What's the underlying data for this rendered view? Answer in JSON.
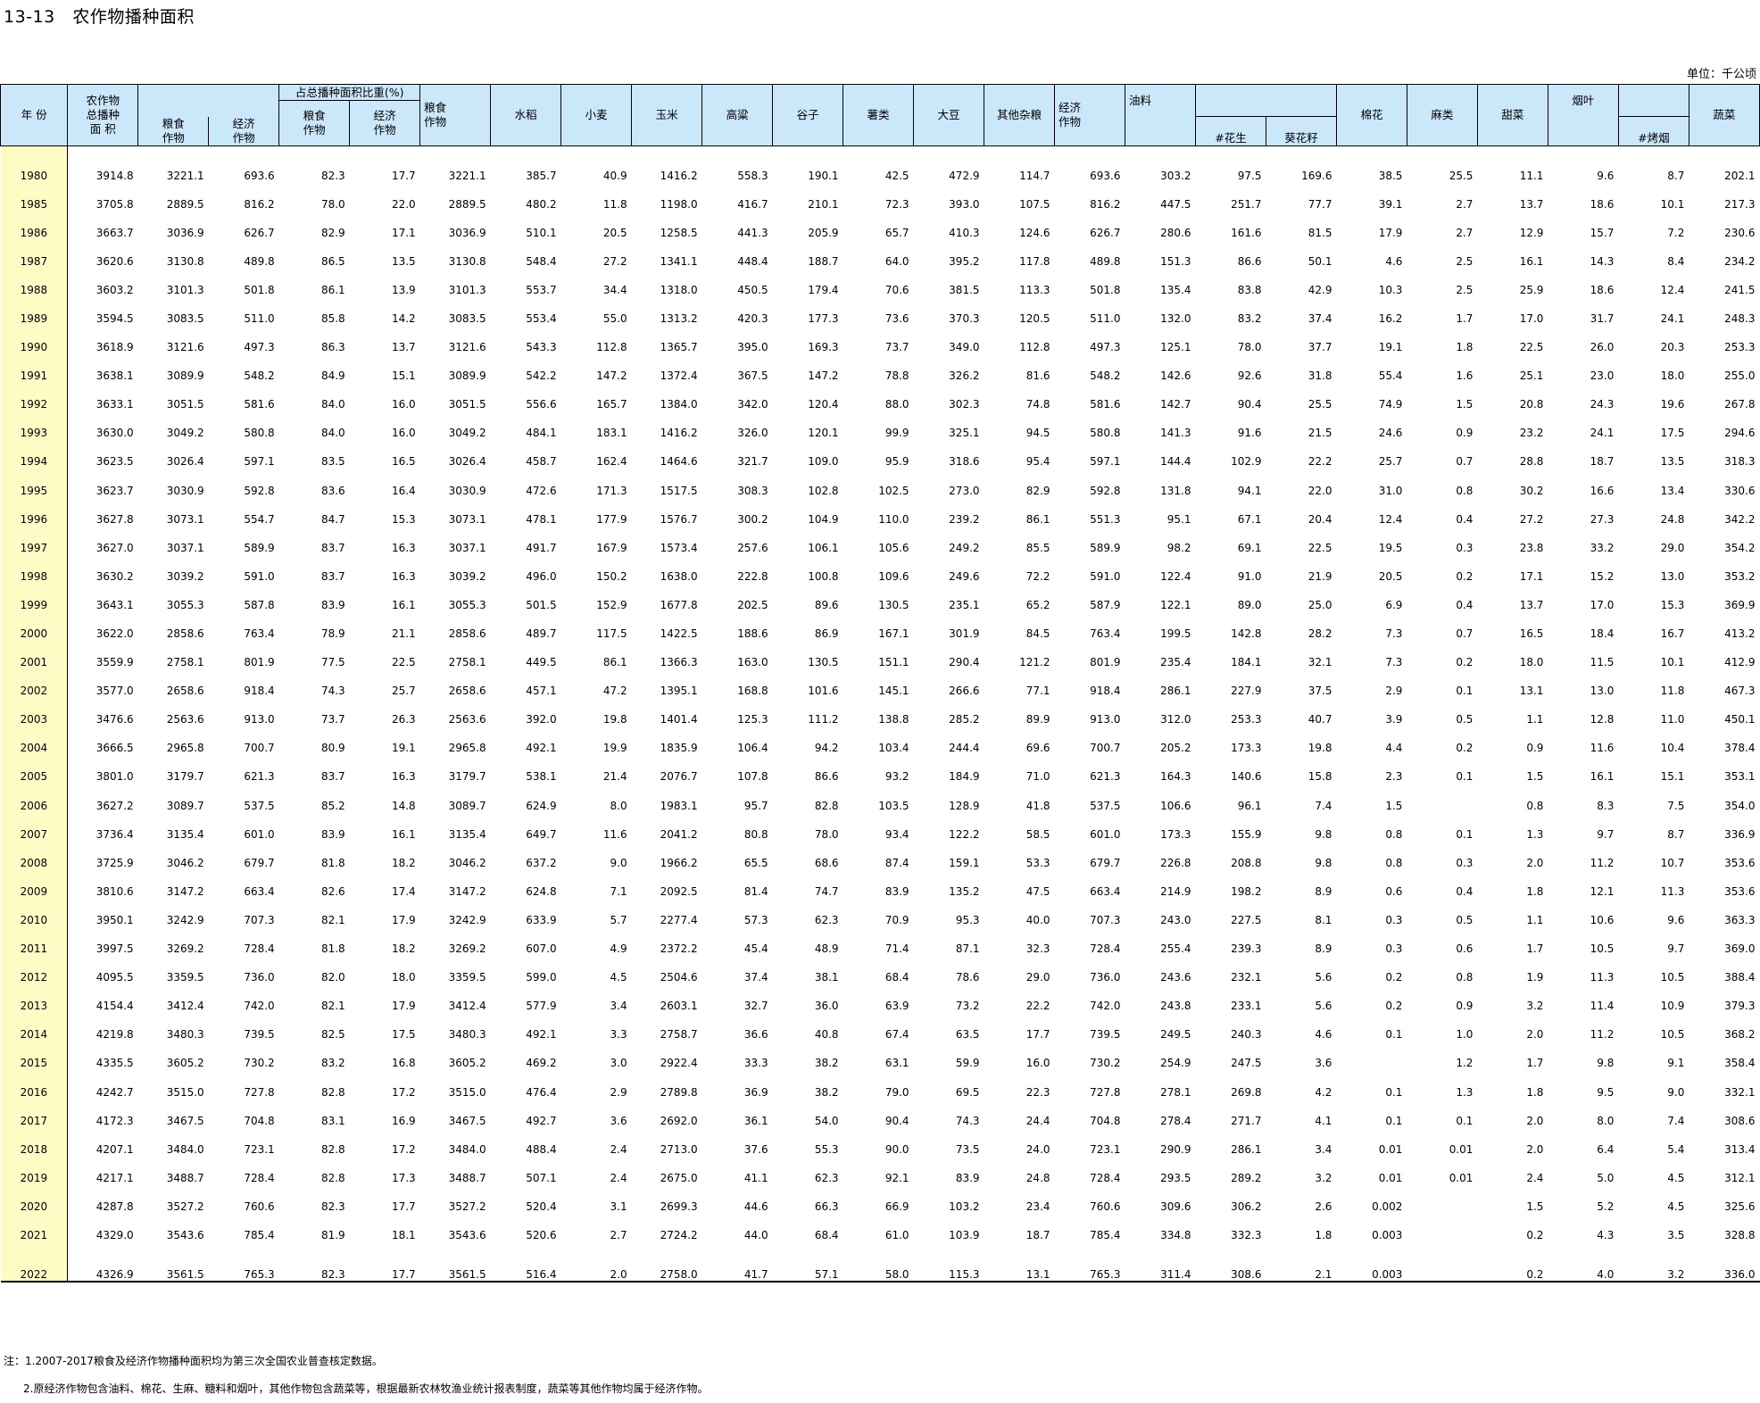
{
  "title": "13-13   农作物播种面积",
  "unit": "单位：千公顷",
  "headers": {
    "year": "年  份",
    "total": "农作物\n总播种\n面 积",
    "grain": "粮食\n作物",
    "cash": "经济\n作物",
    "share_group": "占总播种面积比重(%)",
    "share_grain": "粮食\n作物",
    "share_cash": "经济\n作物",
    "grain_total": "粮食\n作物",
    "rice": "水稻",
    "wheat": "小麦",
    "corn": "玉米",
    "sorghum": "高粱",
    "millet": "谷子",
    "tubers": "薯类",
    "soybean": "大豆",
    "other_grains": "其他杂粮",
    "cash_total": "经济\n作物",
    "oil": "油料",
    "peanut": "#花生",
    "sunflower": "葵花籽",
    "cotton": "棉花",
    "hemp": "麻类",
    "beet": "甜菜",
    "tobacco": "烟叶",
    "flue_tobacco": "#烤烟",
    "vegetables": "蔬菜"
  },
  "rows": [
    [
      "1980",
      "3914.8",
      "3221.1",
      "693.6",
      "82.3",
      "17.7",
      "3221.1",
      "385.7",
      "40.9",
      "1416.2",
      "558.3",
      "190.1",
      "42.5",
      "472.9",
      "114.7",
      "693.6",
      "303.2",
      "97.5",
      "169.6",
      "38.5",
      "25.5",
      "11.1",
      "9.6",
      "8.7",
      "202.1"
    ],
    [
      "1985",
      "3705.8",
      "2889.5",
      "816.2",
      "78.0",
      "22.0",
      "2889.5",
      "480.2",
      "11.8",
      "1198.0",
      "416.7",
      "210.1",
      "72.3",
      "393.0",
      "107.5",
      "816.2",
      "447.5",
      "251.7",
      "77.7",
      "39.1",
      "2.7",
      "13.7",
      "18.6",
      "10.1",
      "217.3"
    ],
    [
      "1986",
      "3663.7",
      "3036.9",
      "626.7",
      "82.9",
      "17.1",
      "3036.9",
      "510.1",
      "20.5",
      "1258.5",
      "441.3",
      "205.9",
      "65.7",
      "410.3",
      "124.6",
      "626.7",
      "280.6",
      "161.6",
      "81.5",
      "17.9",
      "2.7",
      "12.9",
      "15.7",
      "7.2",
      "230.6"
    ],
    [
      "1987",
      "3620.6",
      "3130.8",
      "489.8",
      "86.5",
      "13.5",
      "3130.8",
      "548.4",
      "27.2",
      "1341.1",
      "448.4",
      "188.7",
      "64.0",
      "395.2",
      "117.8",
      "489.8",
      "151.3",
      "86.6",
      "50.1",
      "4.6",
      "2.5",
      "16.1",
      "14.3",
      "8.4",
      "234.2"
    ],
    [
      "1988",
      "3603.2",
      "3101.3",
      "501.8",
      "86.1",
      "13.9",
      "3101.3",
      "553.7",
      "34.4",
      "1318.0",
      "450.5",
      "179.4",
      "70.6",
      "381.5",
      "113.3",
      "501.8",
      "135.4",
      "83.8",
      "42.9",
      "10.3",
      "2.5",
      "25.9",
      "18.6",
      "12.4",
      "241.5"
    ],
    [
      "1989",
      "3594.5",
      "3083.5",
      "511.0",
      "85.8",
      "14.2",
      "3083.5",
      "553.4",
      "55.0",
      "1313.2",
      "420.3",
      "177.3",
      "73.6",
      "370.3",
      "120.5",
      "511.0",
      "132.0",
      "83.2",
      "37.4",
      "16.2",
      "1.7",
      "17.0",
      "31.7",
      "24.1",
      "248.3"
    ],
    [
      "1990",
      "3618.9",
      "3121.6",
      "497.3",
      "86.3",
      "13.7",
      "3121.6",
      "543.3",
      "112.8",
      "1365.7",
      "395.0",
      "169.3",
      "73.7",
      "349.0",
      "112.8",
      "497.3",
      "125.1",
      "78.0",
      "37.7",
      "19.1",
      "1.8",
      "22.5",
      "26.0",
      "20.3",
      "253.3"
    ],
    [
      "1991",
      "3638.1",
      "3089.9",
      "548.2",
      "84.9",
      "15.1",
      "3089.9",
      "542.2",
      "147.2",
      "1372.4",
      "367.5",
      "147.2",
      "78.8",
      "326.2",
      "81.6",
      "548.2",
      "142.6",
      "92.6",
      "31.8",
      "55.4",
      "1.6",
      "25.1",
      "23.0",
      "18.0",
      "255.0"
    ],
    [
      "1992",
      "3633.1",
      "3051.5",
      "581.6",
      "84.0",
      "16.0",
      "3051.5",
      "556.6",
      "165.7",
      "1384.0",
      "342.0",
      "120.4",
      "88.0",
      "302.3",
      "74.8",
      "581.6",
      "142.7",
      "90.4",
      "25.5",
      "74.9",
      "1.5",
      "20.8",
      "24.3",
      "19.6",
      "267.8"
    ],
    [
      "1993",
      "3630.0",
      "3049.2",
      "580.8",
      "84.0",
      "16.0",
      "3049.2",
      "484.1",
      "183.1",
      "1416.2",
      "326.0",
      "120.1",
      "99.9",
      "325.1",
      "94.5",
      "580.8",
      "141.3",
      "91.6",
      "21.5",
      "24.6",
      "0.9",
      "23.2",
      "24.1",
      "17.5",
      "294.6"
    ],
    [
      "1994",
      "3623.5",
      "3026.4",
      "597.1",
      "83.5",
      "16.5",
      "3026.4",
      "458.7",
      "162.4",
      "1464.6",
      "321.7",
      "109.0",
      "95.9",
      "318.6",
      "95.4",
      "597.1",
      "144.4",
      "102.9",
      "22.2",
      "25.7",
      "0.7",
      "28.8",
      "18.7",
      "13.5",
      "318.3"
    ],
    [
      "1995",
      "3623.7",
      "3030.9",
      "592.8",
      "83.6",
      "16.4",
      "3030.9",
      "472.6",
      "171.3",
      "1517.5",
      "308.3",
      "102.8",
      "102.5",
      "273.0",
      "82.9",
      "592.8",
      "131.8",
      "94.1",
      "22.0",
      "31.0",
      "0.8",
      "30.2",
      "16.6",
      "13.4",
      "330.6"
    ],
    [
      "1996",
      "3627.8",
      "3073.1",
      "554.7",
      "84.7",
      "15.3",
      "3073.1",
      "478.1",
      "177.9",
      "1576.7",
      "300.2",
      "104.9",
      "110.0",
      "239.2",
      "86.1",
      "551.3",
      "95.1",
      "67.1",
      "20.4",
      "12.4",
      "0.4",
      "27.2",
      "27.3",
      "24.8",
      "342.2"
    ],
    [
      "1997",
      "3627.0",
      "3037.1",
      "589.9",
      "83.7",
      "16.3",
      "3037.1",
      "491.7",
      "167.9",
      "1573.4",
      "257.6",
      "106.1",
      "105.6",
      "249.2",
      "85.5",
      "589.9",
      "98.2",
      "69.1",
      "22.5",
      "19.5",
      "0.3",
      "23.8",
      "33.2",
      "29.0",
      "354.2"
    ],
    [
      "1998",
      "3630.2",
      "3039.2",
      "591.0",
      "83.7",
      "16.3",
      "3039.2",
      "496.0",
      "150.2",
      "1638.0",
      "222.8",
      "100.8",
      "109.6",
      "249.6",
      "72.2",
      "591.0",
      "122.4",
      "91.0",
      "21.9",
      "20.5",
      "0.2",
      "17.1",
      "15.2",
      "13.0",
      "353.2"
    ],
    [
      "1999",
      "3643.1",
      "3055.3",
      "587.8",
      "83.9",
      "16.1",
      "3055.3",
      "501.5",
      "152.9",
      "1677.8",
      "202.5",
      "89.6",
      "130.5",
      "235.1",
      "65.2",
      "587.9",
      "122.1",
      "89.0",
      "25.0",
      "6.9",
      "0.4",
      "13.7",
      "17.0",
      "15.3",
      "369.9"
    ],
    [
      "2000",
      "3622.0",
      "2858.6",
      "763.4",
      "78.9",
      "21.1",
      "2858.6",
      "489.7",
      "117.5",
      "1422.5",
      "188.6",
      "86.9",
      "167.1",
      "301.9",
      "84.5",
      "763.4",
      "199.5",
      "142.8",
      "28.2",
      "7.3",
      "0.7",
      "16.5",
      "18.4",
      "16.7",
      "413.2"
    ],
    [
      "2001",
      "3559.9",
      "2758.1",
      "801.9",
      "77.5",
      "22.5",
      "2758.1",
      "449.5",
      "86.1",
      "1366.3",
      "163.0",
      "130.5",
      "151.1",
      "290.4",
      "121.2",
      "801.9",
      "235.4",
      "184.1",
      "32.1",
      "7.3",
      "0.2",
      "18.0",
      "11.5",
      "10.1",
      "412.9"
    ],
    [
      "2002",
      "3577.0",
      "2658.6",
      "918.4",
      "74.3",
      "25.7",
      "2658.6",
      "457.1",
      "47.2",
      "1395.1",
      "168.8",
      "101.6",
      "145.1",
      "266.6",
      "77.1",
      "918.4",
      "286.1",
      "227.9",
      "37.5",
      "2.9",
      "0.1",
      "13.1",
      "13.0",
      "11.8",
      "467.3"
    ],
    [
      "2003",
      "3476.6",
      "2563.6",
      "913.0",
      "73.7",
      "26.3",
      "2563.6",
      "392.0",
      "19.8",
      "1401.4",
      "125.3",
      "111.2",
      "138.8",
      "285.2",
      "89.9",
      "913.0",
      "312.0",
      "253.3",
      "40.7",
      "3.9",
      "0.5",
      "1.1",
      "12.8",
      "11.0",
      "450.1"
    ],
    [
      "2004",
      "3666.5",
      "2965.8",
      "700.7",
      "80.9",
      "19.1",
      "2965.8",
      "492.1",
      "19.9",
      "1835.9",
      "106.4",
      "94.2",
      "103.4",
      "244.4",
      "69.6",
      "700.7",
      "205.2",
      "173.3",
      "19.8",
      "4.4",
      "0.2",
      "0.9",
      "11.6",
      "10.4",
      "378.4"
    ],
    [
      "2005",
      "3801.0",
      "3179.7",
      "621.3",
      "83.7",
      "16.3",
      "3179.7",
      "538.1",
      "21.4",
      "2076.7",
      "107.8",
      "86.6",
      "93.2",
      "184.9",
      "71.0",
      "621.3",
      "164.3",
      "140.6",
      "15.8",
      "2.3",
      "0.1",
      "1.5",
      "16.1",
      "15.1",
      "353.1"
    ],
    [
      "2006",
      "3627.2",
      "3089.7",
      "537.5",
      "85.2",
      "14.8",
      "3089.7",
      "624.9",
      "8.0",
      "1983.1",
      "95.7",
      "82.8",
      "103.5",
      "128.9",
      "41.8",
      "537.5",
      "106.6",
      "96.1",
      "7.4",
      "1.5",
      "",
      "0.8",
      "8.3",
      "7.5",
      "354.0"
    ],
    [
      "2007",
      "3736.4",
      "3135.4",
      "601.0",
      "83.9",
      "16.1",
      "3135.4",
      "649.7",
      "11.6",
      "2041.2",
      "80.8",
      "78.0",
      "93.4",
      "122.2",
      "58.5",
      "601.0",
      "173.3",
      "155.9",
      "9.8",
      "0.8",
      "0.1",
      "1.3",
      "9.7",
      "8.7",
      "336.9"
    ],
    [
      "2008",
      "3725.9",
      "3046.2",
      "679.7",
      "81.8",
      "18.2",
      "3046.2",
      "637.2",
      "9.0",
      "1966.2",
      "65.5",
      "68.6",
      "87.4",
      "159.1",
      "53.3",
      "679.7",
      "226.8",
      "208.8",
      "9.8",
      "0.8",
      "0.3",
      "2.0",
      "11.2",
      "10.7",
      "353.6"
    ],
    [
      "2009",
      "3810.6",
      "3147.2",
      "663.4",
      "82.6",
      "17.4",
      "3147.2",
      "624.8",
      "7.1",
      "2092.5",
      "81.4",
      "74.7",
      "83.9",
      "135.2",
      "47.5",
      "663.4",
      "214.9",
      "198.2",
      "8.9",
      "0.6",
      "0.4",
      "1.8",
      "12.1",
      "11.3",
      "353.6"
    ],
    [
      "2010",
      "3950.1",
      "3242.9",
      "707.3",
      "82.1",
      "17.9",
      "3242.9",
      "633.9",
      "5.7",
      "2277.4",
      "57.3",
      "62.3",
      "70.9",
      "95.3",
      "40.0",
      "707.3",
      "243.0",
      "227.5",
      "8.1",
      "0.3",
      "0.5",
      "1.1",
      "10.6",
      "9.6",
      "363.3"
    ],
    [
      "2011",
      "3997.5",
      "3269.2",
      "728.4",
      "81.8",
      "18.2",
      "3269.2",
      "607.0",
      "4.9",
      "2372.2",
      "45.4",
      "48.9",
      "71.4",
      "87.1",
      "32.3",
      "728.4",
      "255.4",
      "239.3",
      "8.9",
      "0.3",
      "0.6",
      "1.7",
      "10.5",
      "9.7",
      "369.0"
    ],
    [
      "2012",
      "4095.5",
      "3359.5",
      "736.0",
      "82.0",
      "18.0",
      "3359.5",
      "599.0",
      "4.5",
      "2504.6",
      "37.4",
      "38.1",
      "68.4",
      "78.6",
      "29.0",
      "736.0",
      "243.6",
      "232.1",
      "5.6",
      "0.2",
      "0.8",
      "1.9",
      "11.3",
      "10.5",
      "388.4"
    ],
    [
      "2013",
      "4154.4",
      "3412.4",
      "742.0",
      "82.1",
      "17.9",
      "3412.4",
      "577.9",
      "3.4",
      "2603.1",
      "32.7",
      "36.0",
      "63.9",
      "73.2",
      "22.2",
      "742.0",
      "243.8",
      "233.1",
      "5.6",
      "0.2",
      "0.9",
      "3.2",
      "11.4",
      "10.9",
      "379.3"
    ],
    [
      "2014",
      "4219.8",
      "3480.3",
      "739.5",
      "82.5",
      "17.5",
      "3480.3",
      "492.1",
      "3.3",
      "2758.7",
      "36.6",
      "40.8",
      "67.4",
      "63.5",
      "17.7",
      "739.5",
      "249.5",
      "240.3",
      "4.6",
      "0.1",
      "1.0",
      "2.0",
      "11.2",
      "10.5",
      "368.2"
    ],
    [
      "2015",
      "4335.5",
      "3605.2",
      "730.2",
      "83.2",
      "16.8",
      "3605.2",
      "469.2",
      "3.0",
      "2922.4",
      "33.3",
      "38.2",
      "63.1",
      "59.9",
      "16.0",
      "730.2",
      "254.9",
      "247.5",
      "3.6",
      "",
      "1.2",
      "1.7",
      "9.8",
      "9.1",
      "358.4"
    ],
    [
      "2016",
      "4242.7",
      "3515.0",
      "727.8",
      "82.8",
      "17.2",
      "3515.0",
      "476.4",
      "2.9",
      "2789.8",
      "36.9",
      "38.2",
      "79.0",
      "69.5",
      "22.3",
      "727.8",
      "278.1",
      "269.8",
      "4.2",
      "0.1",
      "1.3",
      "1.8",
      "9.5",
      "9.0",
      "332.1"
    ],
    [
      "2017",
      "4172.3",
      "3467.5",
      "704.8",
      "83.1",
      "16.9",
      "3467.5",
      "492.7",
      "3.6",
      "2692.0",
      "36.1",
      "54.0",
      "90.4",
      "74.3",
      "24.4",
      "704.8",
      "278.4",
      "271.7",
      "4.1",
      "0.1",
      "0.1",
      "2.0",
      "8.0",
      "7.4",
      "308.6"
    ],
    [
      "2018",
      "4207.1",
      "3484.0",
      "723.1",
      "82.8",
      "17.2",
      "3484.0",
      "488.4",
      "2.4",
      "2713.0",
      "37.6",
      "55.3",
      "90.0",
      "73.5",
      "24.0",
      "723.1",
      "290.9",
      "286.1",
      "3.4",
      "0.01",
      "0.01",
      "2.0",
      "6.4",
      "5.4",
      "313.4"
    ],
    [
      "2019",
      "4217.1",
      "3488.7",
      "728.4",
      "82.8",
      "17.3",
      "3488.7",
      "507.1",
      "2.4",
      "2675.0",
      "41.1",
      "62.3",
      "92.1",
      "83.9",
      "24.8",
      "728.4",
      "293.5",
      "289.2",
      "3.2",
      "0.01",
      "0.01",
      "2.4",
      "5.0",
      "4.5",
      "312.1"
    ],
    [
      "2020",
      "4287.8",
      "3527.2",
      "760.6",
      "82.3",
      "17.7",
      "3527.2",
      "520.4",
      "3.1",
      "2699.3",
      "44.6",
      "66.3",
      "66.9",
      "103.2",
      "23.4",
      "760.6",
      "309.6",
      "306.2",
      "2.6",
      "0.002",
      "",
      "1.5",
      "5.2",
      "4.5",
      "325.6"
    ],
    [
      "2021",
      "4329.0",
      "3543.6",
      "785.4",
      "81.9",
      "18.1",
      "3543.6",
      "520.6",
      "2.7",
      "2724.2",
      "44.0",
      "68.4",
      "61.0",
      "103.9",
      "18.7",
      "785.4",
      "334.8",
      "332.3",
      "1.8",
      "0.003",
      "",
      "0.2",
      "4.3",
      "3.5",
      "328.8"
    ],
    [
      "2022",
      "4326.9",
      "3561.5",
      "765.3",
      "82.3",
      "17.7",
      "3561.5",
      "516.4",
      "2.0",
      "2758.0",
      "41.7",
      "57.1",
      "58.0",
      "115.3",
      "13.1",
      "765.3",
      "311.4",
      "308.6",
      "2.1",
      "0.003",
      "",
      "0.2",
      "4.0",
      "3.2",
      "336.0"
    ]
  ],
  "notes": [
    "注：1.2007-2017粮食及经济作物播种面积均为第三次全国农业普查核定数据。",
    "2.原经济作物包含油料、棉花、生麻、糖料和烟叶，其他作物包含蔬菜等，根据最新农林牧渔业统计报表制度，蔬菜等其他作物均属于经济作物。"
  ]
}
